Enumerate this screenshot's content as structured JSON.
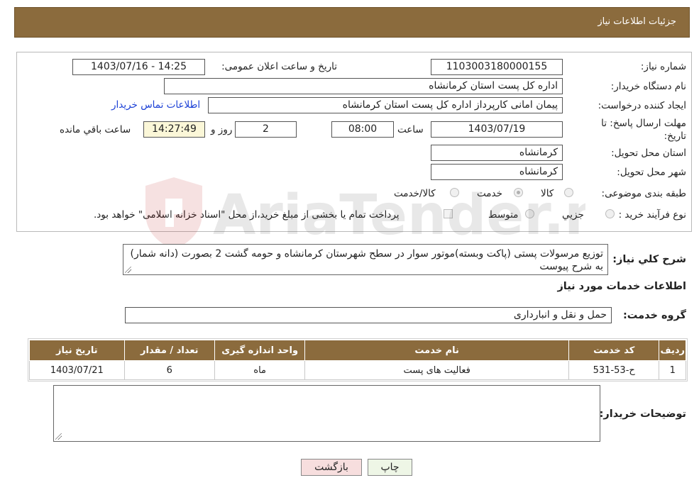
{
  "header": {
    "title": "جزئیات اطلاعات نیاز"
  },
  "form": {
    "need_number_label": "شماره نیاز:",
    "need_number": "1103003180000155",
    "announce_label": "تاریخ و ساعت اعلان عمومی:",
    "announce_value": "1403/07/16 - 14:25",
    "buyer_org_label": "نام دستگاه خریدار:",
    "buyer_org": "اداره کل پست استان کرمانشاه",
    "creator_label": "ایجاد کننده درخواست:",
    "creator": "پیمان امانی کارپرداز اداره کل پست استان کرمانشاه",
    "contact_link": "اطلاعات تماس خریدار",
    "deadline_label_1": "مهلت ارسال پاسخ: تا",
    "deadline_label_2": "تاریخ:",
    "deadline_date": "1403/07/19",
    "time_label": "ساعت",
    "deadline_time": "08:00",
    "days_value": "2",
    "days_label": "روز و",
    "remaining_time": "14:27:49",
    "remaining_label": "ساعت باقي مانده",
    "province_label": "استان محل تحویل:",
    "province": "کرمانشاه",
    "city_label": "شهر محل تحویل:",
    "city": "کرمانشاه",
    "category_label": "طبقه بندی موضوعی:",
    "category_options": [
      "کالا",
      "خدمت",
      "کالا/خدمت"
    ],
    "category_selected": "خدمت",
    "process_label": "نوع فرآیند خرید :",
    "process_options": [
      "جزیي",
      "متوسط"
    ],
    "payment_note": "پرداخت تمام یا بخشی از مبلغ خرید،از محل \"اسناد خزانه اسلامی\" خواهد بود."
  },
  "description": {
    "label": "شرح كلي نياز:",
    "text": "توزیع مرسولات پستی (پاکت وبسته)موتور سوار در سطح شهرستان کرمانشاه و حومه گشت 2 بصورت (دانه شمار)  به شرح پیوست"
  },
  "services": {
    "section_title": "اطلاعات خدمات مورد نياز",
    "group_label": "گروه خدمت:",
    "group_value": "حمل و نقل و انبارداری",
    "columns": [
      "ردیف",
      "کد خدمت",
      "نام خدمت",
      "واحد اندازه گیری",
      "تعداد / مقدار",
      "تاریخ نیاز"
    ],
    "rows": [
      {
        "row": "1",
        "code": "ح-53-531",
        "name": "فعالیت های پست",
        "unit": "ماه",
        "qty": "6",
        "date": "1403/07/21"
      }
    ]
  },
  "buyer_notes": {
    "label": "توضیحات خریدار:",
    "value": ""
  },
  "buttons": {
    "print": "چاپ",
    "back": "بازگشت"
  },
  "watermark": {
    "text": "AriaTender.neT"
  },
  "colors": {
    "header_bg": "#8b6b3d",
    "link": "#1a3fd6",
    "back_button": "#f7dede",
    "print_button": "#eef6e6"
  }
}
